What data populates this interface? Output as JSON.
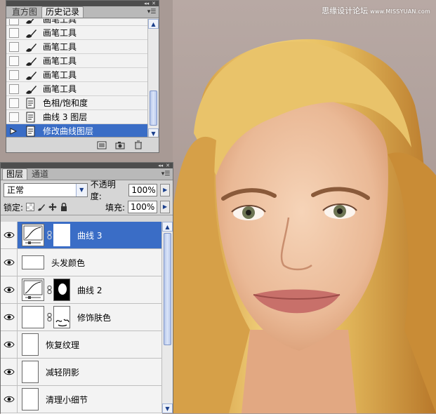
{
  "watermark": {
    "text": "思缘设计论坛",
    "url": "www.MISSYUAN.com"
  },
  "history": {
    "tabs": [
      "直方图",
      "历史记录"
    ],
    "active_tab": 1,
    "items": [
      {
        "label": "画笔工具",
        "icon": "brush-icon"
      },
      {
        "label": "画笔工具",
        "icon": "brush-icon"
      },
      {
        "label": "画笔工具",
        "icon": "brush-icon"
      },
      {
        "label": "画笔工具",
        "icon": "brush-icon"
      },
      {
        "label": "画笔工具",
        "icon": "brush-icon"
      },
      {
        "label": "画笔工具",
        "icon": "brush-icon"
      },
      {
        "label": "色相/饱和度",
        "icon": "document-icon"
      },
      {
        "label": "曲线 3 图层",
        "icon": "document-icon"
      },
      {
        "label": "修改曲线图层",
        "icon": "document-icon",
        "selected": true
      }
    ]
  },
  "layers": {
    "tabs": [
      "图层",
      "通道"
    ],
    "active_tab": 0,
    "blend_mode": "正常",
    "opacity_label": "不透明度:",
    "opacity": "100%",
    "lock_label": "锁定:",
    "fill_label": "填充:",
    "fill": "100%",
    "items": [
      {
        "name": "曲线 3",
        "type": "curves",
        "mask": "white",
        "selected": true
      },
      {
        "name": "头发颜色",
        "type": "pixel"
      },
      {
        "name": "曲线 2",
        "type": "curves",
        "mask": "black-blob"
      },
      {
        "name": "修饰肤色",
        "type": "pixel",
        "mask": "white-strokes"
      },
      {
        "name": "恢复纹理",
        "type": "pixel"
      },
      {
        "name": "减轻阴影",
        "type": "pixel"
      },
      {
        "name": "清理小细节",
        "type": "pixel"
      }
    ]
  }
}
